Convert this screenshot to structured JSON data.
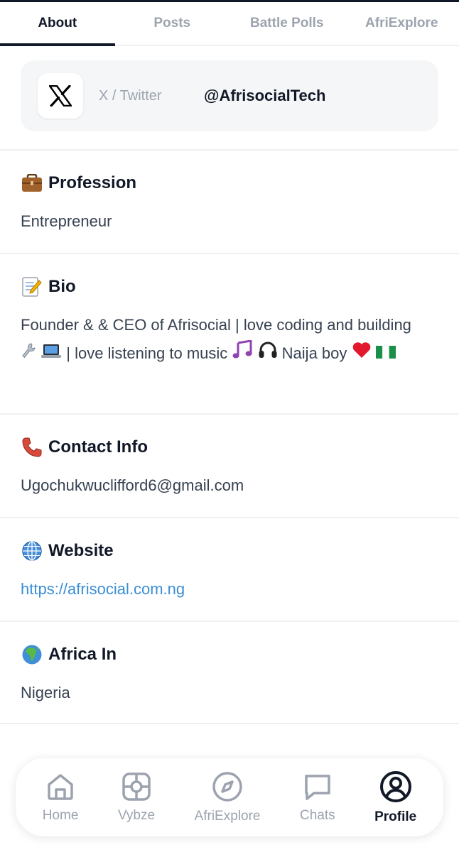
{
  "tabs": [
    "About",
    "Posts",
    "Battle Polls",
    "AfriExplore"
  ],
  "social": {
    "icon": "x-logo-icon",
    "platform": "X / Twitter",
    "handle": "@AfrisocialTech"
  },
  "sections": {
    "profession": {
      "icon": "briefcase-icon",
      "title": "Profession",
      "value": "Entrepreneur"
    },
    "bio": {
      "icon": "memo-icon",
      "title": "Bio",
      "part1": "Founder & & CEO of Afrisocial | love coding and building",
      "part2": "| love listening to music",
      "part3": "Naija boy"
    },
    "contact": {
      "icon": "telephone-icon",
      "title": "Contact Info",
      "value": "Ugochukwuclifford6@gmail.com"
    },
    "website": {
      "icon": "globe-icon",
      "title": "Website",
      "value": "https://afrisocial.com.ng"
    },
    "africa": {
      "icon": "earth-africa-icon",
      "title": "Africa In",
      "value": "Nigeria"
    }
  },
  "nav": [
    {
      "label": "Home",
      "icon": "home-icon",
      "active": false
    },
    {
      "label": "Vybze",
      "icon": "vybze-icon",
      "active": false
    },
    {
      "label": "AfriExplore",
      "icon": "compass-icon",
      "active": false
    },
    {
      "label": "Chats",
      "icon": "chat-bubble-icon",
      "active": false
    },
    {
      "label": "Profile",
      "icon": "user-circle-icon",
      "active": true
    }
  ],
  "colors": {
    "link": "#3b8ed6",
    "active": "#111827",
    "muted": "#9ca3af"
  }
}
